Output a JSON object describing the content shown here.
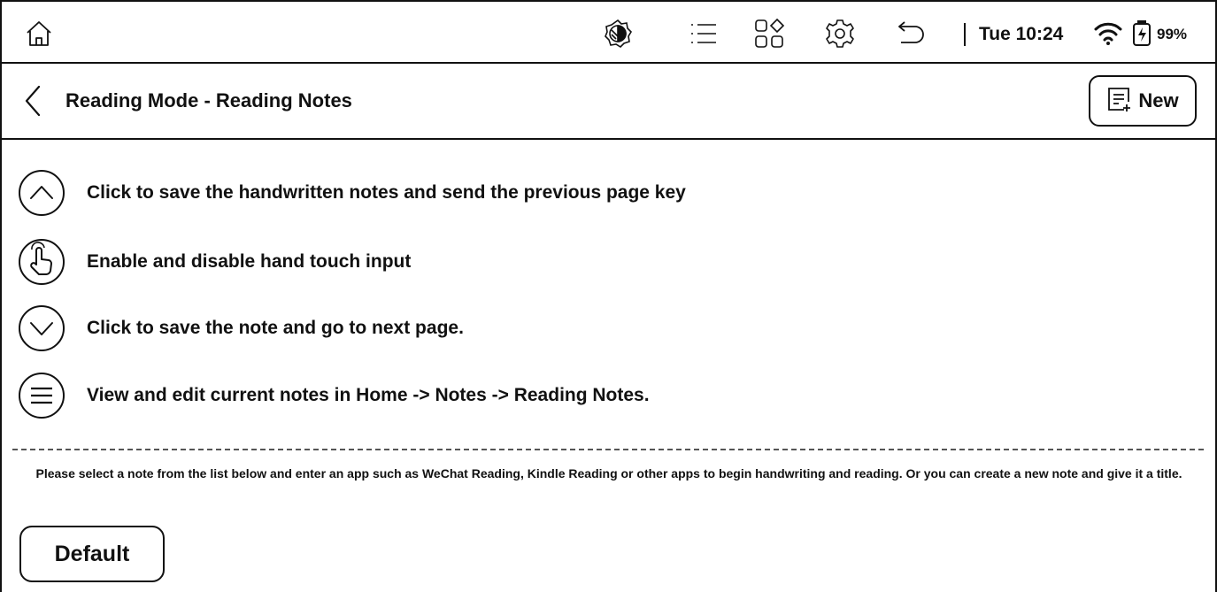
{
  "statusbar": {
    "icons": [
      "home-icon",
      "contrast-icon",
      "menu-list-icon",
      "apps-grid-icon",
      "settings-icon",
      "back-arrow-icon",
      "wifi-icon",
      "battery-charging-icon"
    ],
    "time": "Tue 10:24",
    "battery": "99%"
  },
  "header": {
    "title": "Reading Mode - Reading Notes",
    "new_label": "New"
  },
  "legend": [
    {
      "icon": "chevron-up-icon",
      "text": "Click to save the handwritten notes and send the previous page key"
    },
    {
      "icon": "hand-touch-icon",
      "text": "Enable and disable hand touch input"
    },
    {
      "icon": "chevron-down-icon",
      "text": "Click to save the note and go to next page."
    },
    {
      "icon": "menu-icon",
      "text": "View and edit current notes in Home -> Notes -> Reading Notes."
    }
  ],
  "info_text": "Please select a note from the list below and enter an app such as WeChat Reading, Kindle Reading or other apps to begin handwriting and reading. Or you can create a new note and give it a title.",
  "notes": [
    {
      "label": "Default"
    }
  ]
}
